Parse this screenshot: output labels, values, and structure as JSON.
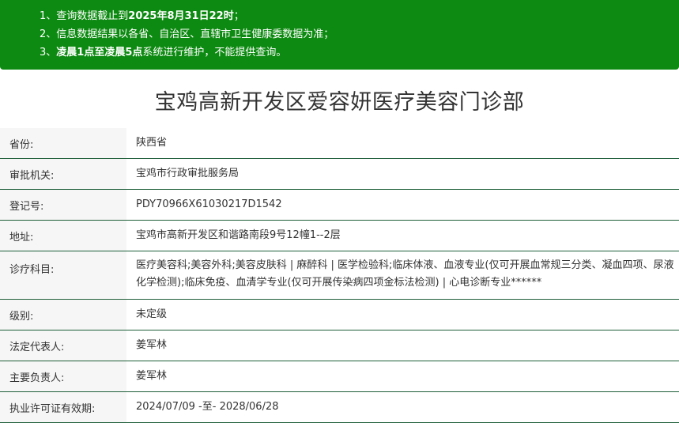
{
  "notice": {
    "line1": {
      "prefix": "1、查询数据截止到",
      "bold": "2025年8月31日22时",
      "suffix": "；"
    },
    "line2": {
      "text": "2、信息数据结果以各省、自治区、直辖市卫生健康委数据为准；"
    },
    "line3": {
      "prefix": "3、",
      "bold": "凌晨1点至凌晨5点",
      "suffix": "系统进行维护，不能提供查询。"
    }
  },
  "title": "宝鸡高新开发区爱容妍医疗美容门诊部",
  "fields": [
    {
      "label": "省份:",
      "value": "陕西省"
    },
    {
      "label": "审批机关:",
      "value": "宝鸡市行政审批服务局"
    },
    {
      "label": "登记号:",
      "value": "PDY70966X61030217D1542"
    },
    {
      "label": "地址:",
      "value": "宝鸡市高新开发区和谐路南段9号12幢1--2层"
    },
    {
      "label": "诊疗科目:",
      "value": "医疗美容科;美容外科;美容皮肤科 | 麻醉科 | 医学检验科;临床体液、血液专业(仅可开展血常规三分类、凝血四项、尿液化学检测);临床免疫、血清学专业(仅可开展传染病四项金标法检测) | 心电诊断专业******"
    },
    {
      "label": "级别:",
      "value": "未定级"
    },
    {
      "label": "法定代表人:",
      "value": "姜军林"
    },
    {
      "label": "主要负责人:",
      "value": "姜军林"
    },
    {
      "label": "执业许可证有效期:",
      "value": "2024/07/09 -至- 2028/06/28"
    }
  ],
  "colors": {
    "notice_bg": "#0d8a11",
    "row_border": "#1f5f3a",
    "label_bg": "#f6f6f6"
  }
}
